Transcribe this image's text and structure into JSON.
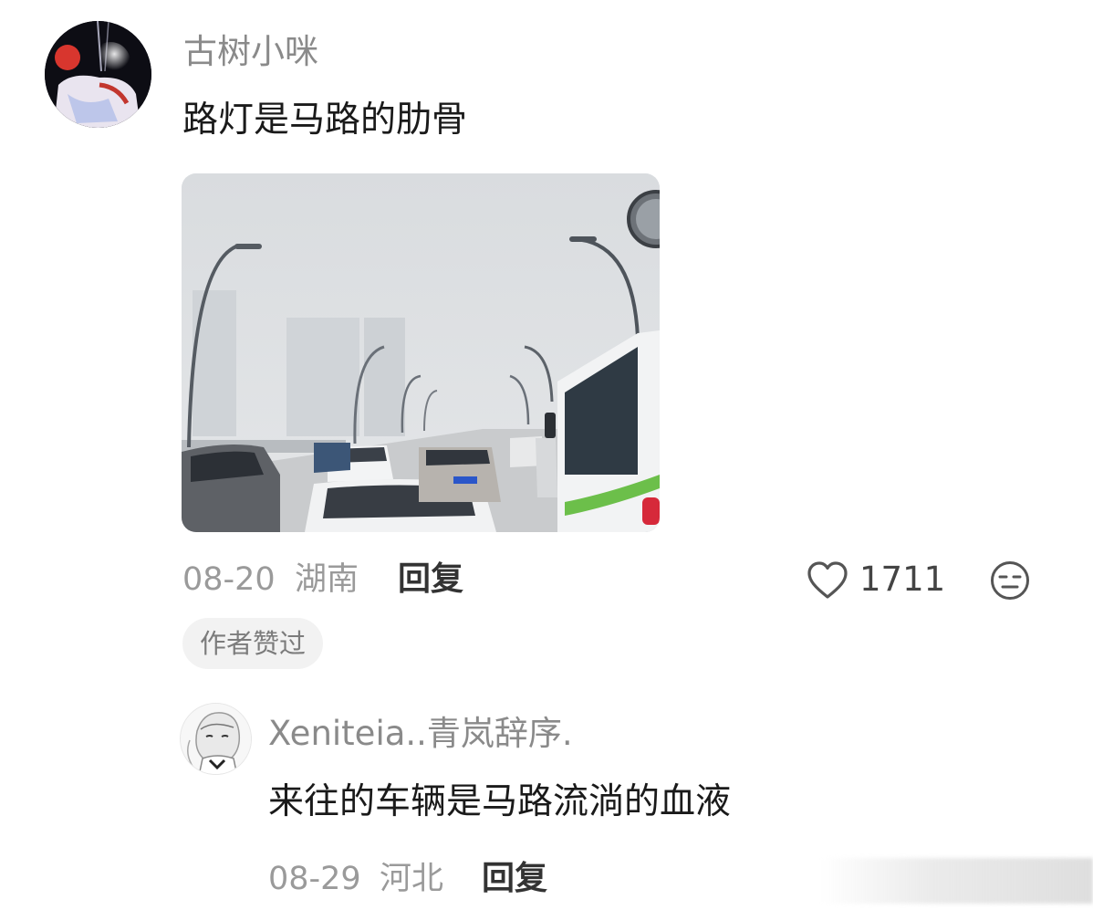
{
  "comment": {
    "username": "古树小咪",
    "text": "路灯是马路的肋骨",
    "date": "08-20",
    "location": "湖南",
    "reply_label": "回复",
    "like_count": "1711",
    "badge": "作者赞过"
  },
  "sub_reply": {
    "username": "Xeniteia..青岚辞序.",
    "text": "来往的车辆是马路流淌的血液",
    "date": "08-29",
    "location": "河北",
    "reply_label": "回复"
  },
  "icons": {
    "like": "heart-outline-icon",
    "reaction": "neutral-face-icon"
  },
  "colors": {
    "username": "#8a8a8a",
    "text": "#1a1a1a",
    "meta": "#9a9a9a",
    "badge_bg": "#f2f2f2"
  }
}
